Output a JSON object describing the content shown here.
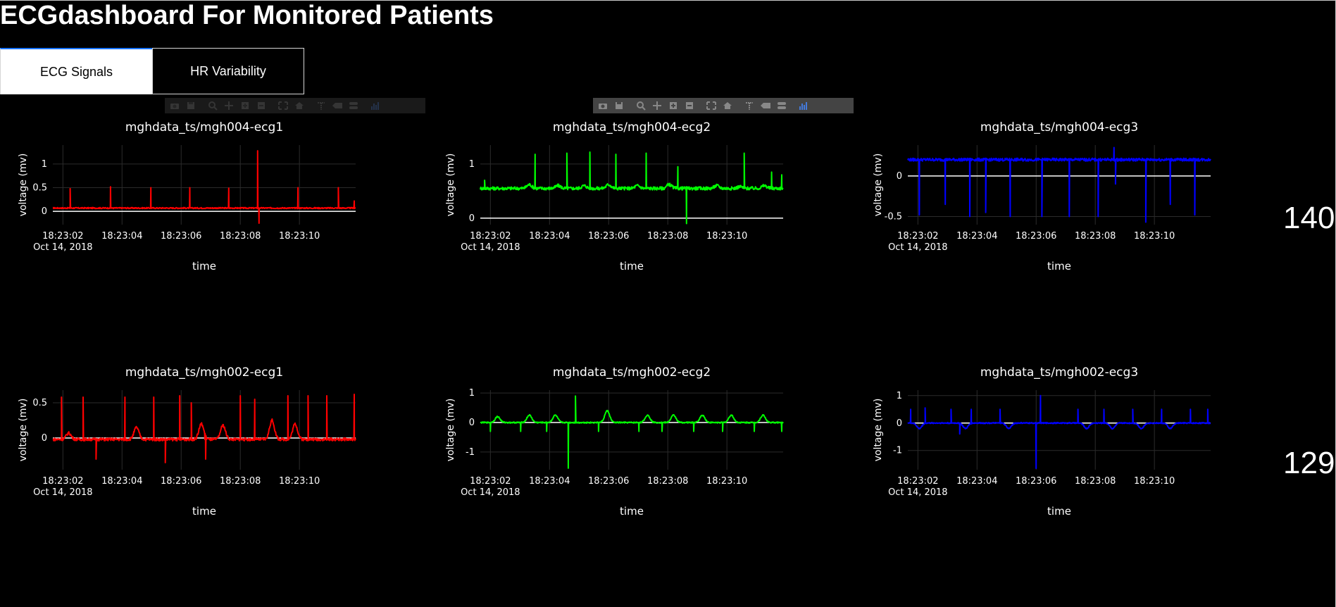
{
  "header": {
    "title": "ECGdashboard For Monitored Patients"
  },
  "tabs": [
    {
      "label": "ECG Signals",
      "active": true
    },
    {
      "label": "HR Variability",
      "active": false
    }
  ],
  "modebar_icons": [
    "camera-icon",
    "save-icon",
    "zoom-icon",
    "pan-icon",
    "zoom-in-icon",
    "zoom-out-icon",
    "autoscale-icon",
    "home-icon",
    "spike-lines-icon",
    "hover-closest-icon",
    "hover-compare-icon",
    "plotly-logo-icon"
  ],
  "heart_rates": [
    {
      "patient": "mgh004",
      "value": "140"
    },
    {
      "patient": "mgh002",
      "value": "129"
    }
  ],
  "chart_data": [
    {
      "type": "line",
      "title": "mghdata_ts/mgh004-ecg1",
      "xlabel": "time",
      "ylabel": "voltage (mv)",
      "color": "#ff0000",
      "x_ticks": [
        "18:23:02",
        "18:23:04",
        "18:23:06",
        "18:23:08",
        "18:23:10"
      ],
      "x_date": "Oct 14, 2018",
      "y_ticks": [
        0,
        0.5,
        1
      ],
      "ylim": [
        -0.28,
        1.4
      ],
      "xlim": [
        0,
        10.5
      ],
      "waveform": {
        "baseline": 0.07,
        "noise": 0.012,
        "beats": [
          [
            0.6,
            0.48
          ],
          [
            2.0,
            0.52
          ],
          [
            3.4,
            0.5
          ],
          [
            4.75,
            0.5
          ],
          [
            6.1,
            0.49
          ],
          [
            7.1,
            1.28
          ],
          [
            7.15,
            -0.25
          ],
          [
            8.5,
            0.5
          ],
          [
            9.9,
            0.5
          ],
          [
            10.45,
            0.22
          ]
        ],
        "waves": []
      }
    },
    {
      "type": "line",
      "title": "mghdata_ts/mgh004-ecg2",
      "xlabel": "time",
      "ylabel": "voltage (mv)",
      "color": "#00ff00",
      "x_ticks": [
        "18:23:02",
        "18:23:04",
        "18:23:06",
        "18:23:08",
        "18:23:10"
      ],
      "x_date": "Oct 14, 2018",
      "y_ticks": [
        0,
        1
      ],
      "ylim": [
        -0.12,
        1.35
      ],
      "xlim": [
        0,
        10.5
      ],
      "waveform": {
        "baseline": 0.55,
        "noise": 0.03,
        "beats": [
          [
            0.15,
            0.7
          ],
          [
            1.9,
            1.18
          ],
          [
            3.0,
            1.2
          ],
          [
            3.8,
            1.22
          ],
          [
            4.7,
            1.18
          ],
          [
            5.75,
            1.2
          ],
          [
            6.85,
            0.95
          ],
          [
            7.15,
            -0.1
          ],
          [
            9.15,
            1.2
          ],
          [
            10.1,
            0.85
          ],
          [
            10.45,
            0.8
          ]
        ],
        "waves": [
          [
            1.7,
            0.62
          ],
          [
            2.7,
            0.6
          ],
          [
            3.6,
            0.6
          ],
          [
            4.45,
            0.62
          ],
          [
            5.45,
            0.6
          ],
          [
            6.55,
            0.62
          ],
          [
            8.2,
            0.6
          ],
          [
            9.0,
            0.58
          ],
          [
            9.85,
            0.6
          ]
        ]
      }
    },
    {
      "type": "line",
      "title": "mghdata_ts/mgh004-ecg3",
      "xlabel": "time",
      "ylabel": "voltage (mv)",
      "color": "#0000ff",
      "x_ticks": [
        "18:23:02",
        "18:23:04",
        "18:23:06",
        "18:23:08",
        "18:23:10"
      ],
      "x_date": "Oct 14, 2018",
      "y_ticks": [
        -0.5,
        0
      ],
      "ylim": [
        -0.6,
        0.38
      ],
      "xlim": [
        0,
        10.5
      ],
      "waveform": {
        "baseline": 0.2,
        "noise": 0.018,
        "beats": [
          [
            0.4,
            -0.48
          ],
          [
            1.3,
            -0.35
          ],
          [
            2.15,
            -0.5
          ],
          [
            2.7,
            -0.45
          ],
          [
            3.55,
            -0.5
          ],
          [
            4.65,
            -0.5
          ],
          [
            5.6,
            -0.5
          ],
          [
            6.6,
            -0.5
          ],
          [
            7.15,
            0.35
          ],
          [
            7.2,
            -0.1
          ],
          [
            8.25,
            -0.57
          ],
          [
            9.1,
            -0.35
          ],
          [
            9.95,
            -0.48
          ]
        ],
        "waves": []
      }
    },
    {
      "type": "line",
      "title": "mghdata_ts/mgh002-ecg1",
      "xlabel": "time",
      "ylabel": "voltage (mv)",
      "color": "#ff0000",
      "x_ticks": [
        "18:23:02",
        "18:23:04",
        "18:23:06",
        "18:23:08",
        "18:23:10"
      ],
      "x_date": "Oct 14, 2018",
      "y_ticks": [
        0,
        0.5
      ],
      "ylim": [
        -0.45,
        0.68
      ],
      "xlim": [
        0,
        10.5
      ],
      "waveform": {
        "baseline": -0.02,
        "noise": 0.02,
        "beats": [
          [
            0.3,
            0.58
          ],
          [
            1.05,
            0.58
          ],
          [
            1.5,
            -0.3
          ],
          [
            2.5,
            0.58
          ],
          [
            3.5,
            0.58
          ],
          [
            3.9,
            -0.35
          ],
          [
            4.4,
            0.6
          ],
          [
            4.8,
            0.5
          ],
          [
            5.3,
            -0.3
          ],
          [
            6.5,
            0.6
          ],
          [
            7.0,
            0.55
          ],
          [
            8.15,
            0.6
          ],
          [
            8.85,
            0.6
          ],
          [
            9.5,
            0.6
          ],
          [
            10.45,
            0.62
          ]
        ],
        "waves": [
          [
            0.55,
            0.07
          ],
          [
            2.9,
            0.15
          ],
          [
            5.15,
            0.2
          ],
          [
            5.9,
            0.18
          ],
          [
            7.6,
            0.25
          ],
          [
            8.4,
            0.2
          ]
        ]
      }
    },
    {
      "type": "line",
      "title": "mghdata_ts/mgh002-ecg2",
      "xlabel": "time",
      "ylabel": "voltage (mv)",
      "color": "#00ff00",
      "x_ticks": [
        "18:23:02",
        "18:23:04",
        "18:23:06",
        "18:23:08",
        "18:23:10"
      ],
      "x_date": "Oct 14, 2018",
      "y_ticks": [
        -1,
        0,
        1
      ],
      "ylim": [
        -1.6,
        1.1
      ],
      "xlim": [
        0,
        10.5
      ],
      "waveform": {
        "baseline": 0.0,
        "noise": 0.02,
        "beats": [
          [
            0.35,
            -0.3
          ],
          [
            1.4,
            -0.3
          ],
          [
            2.3,
            -0.3
          ],
          [
            3.05,
            -1.55
          ],
          [
            3.3,
            0.9
          ],
          [
            4.1,
            -0.3
          ],
          [
            5.5,
            -0.3
          ],
          [
            6.3,
            -0.3
          ],
          [
            7.4,
            -0.3
          ],
          [
            8.4,
            -0.3
          ],
          [
            9.5,
            -0.3
          ],
          [
            10.45,
            -0.3
          ]
        ],
        "waves": [
          [
            0.6,
            0.2
          ],
          [
            1.7,
            0.25
          ],
          [
            2.6,
            0.25
          ],
          [
            4.4,
            0.4
          ],
          [
            5.8,
            0.25
          ],
          [
            6.7,
            0.25
          ],
          [
            7.7,
            0.25
          ],
          [
            8.7,
            0.25
          ],
          [
            9.8,
            0.25
          ]
        ]
      }
    },
    {
      "type": "line",
      "title": "mghdata_ts/mgh002-ecg3",
      "xlabel": "time",
      "ylabel": "voltage (mv)",
      "color": "#0000ff",
      "x_ticks": [
        "18:23:02",
        "18:23:04",
        "18:23:06",
        "18:23:08",
        "18:23:10"
      ],
      "x_date": "Oct 14, 2018",
      "y_ticks": [
        -1,
        0,
        1
      ],
      "ylim": [
        -1.7,
        1.2
      ],
      "xlim": [
        0,
        10.5
      ],
      "waveform": {
        "baseline": 0.0,
        "noise": 0.02,
        "beats": [
          [
            0.1,
            0.5
          ],
          [
            0.6,
            0.55
          ],
          [
            1.5,
            0.5
          ],
          [
            1.8,
            -0.4
          ],
          [
            2.2,
            0.5
          ],
          [
            3.2,
            0.5
          ],
          [
            4.45,
            -1.65
          ],
          [
            4.6,
            1.0
          ],
          [
            5.9,
            0.5
          ],
          [
            6.8,
            0.5
          ],
          [
            7.8,
            0.5
          ],
          [
            8.8,
            0.5
          ],
          [
            9.8,
            0.5
          ],
          [
            10.4,
            0.5
          ]
        ],
        "waves": [
          [
            0.4,
            -0.2
          ],
          [
            2.0,
            -0.2
          ],
          [
            3.5,
            -0.2
          ],
          [
            6.2,
            -0.2
          ],
          [
            7.1,
            -0.2
          ],
          [
            8.1,
            -0.2
          ],
          [
            9.1,
            -0.2
          ]
        ]
      }
    }
  ]
}
